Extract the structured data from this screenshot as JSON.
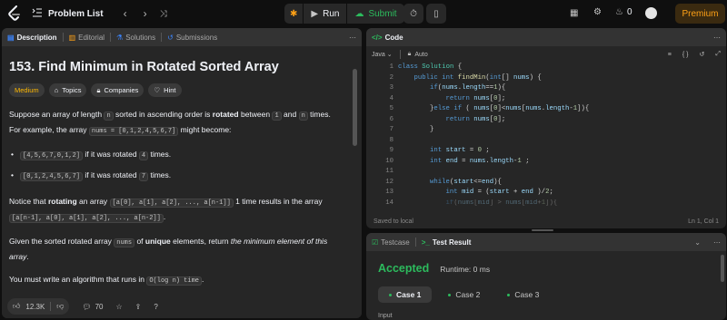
{
  "topbar": {
    "problem_list_label": "Problem List",
    "run_label": "Run",
    "submit_label": "Submit",
    "streak_count": "0",
    "premium_label": "Premium"
  },
  "description_panel": {
    "tabs": [
      {
        "label": "Description"
      },
      {
        "label": "Editorial"
      },
      {
        "label": "Solutions"
      },
      {
        "label": "Submissions"
      }
    ],
    "title": "153. Find Minimum in Rotated Sorted Array",
    "difficulty": "Medium",
    "tags": {
      "topics": "Topics",
      "companies": "Companies",
      "hint": "Hint"
    },
    "para1": {
      "a": "Suppose an array of length ",
      "n1": "n",
      "b": " sorted in ascending order is ",
      "rotated": "rotated",
      "c": " between ",
      "one": "1",
      "d": " and ",
      "n2": "n",
      "e": " times. For example, the array ",
      "nums": "nums = [0,1,2,4,5,6,7]",
      "f": " might become:"
    },
    "bullets": [
      {
        "code": "[4,5,6,7,0,1,2]",
        "text1": " if it was rotated ",
        "num": "4",
        "text2": " times."
      },
      {
        "code": "[0,1,2,4,5,6,7]",
        "text1": " if it was rotated ",
        "num": "7",
        "text2": " times."
      }
    ],
    "para2": {
      "a": "Notice that ",
      "rotating": "rotating",
      "b": " an array ",
      "code1": "[a[0], a[1], a[2], ..., a[n-1]]",
      "c": " 1 time results in the array ",
      "code2": "[a[n-1], a[0], a[1], a[2], ..., a[n-2]]",
      "d": "."
    },
    "para3": {
      "a": "Given the sorted rotated array ",
      "nums": "nums",
      "b": " of ",
      "unique": "unique",
      "c": " elements, return ",
      "em": "the minimum element of this array",
      "d": "."
    },
    "para4": {
      "a": "You must write an algorithm that runs in ",
      "code": "O(log n) time",
      "b": "."
    },
    "footer": {
      "likes": "12.3K",
      "comments": "70"
    }
  },
  "code_panel": {
    "tab_label": "Code",
    "language": "Java",
    "autosave": "Auto",
    "line_numbers": [
      "1",
      "2",
      "3",
      "4",
      "5",
      "6",
      "7",
      "8",
      "9",
      "10",
      "11",
      "12",
      "13",
      "14"
    ],
    "status_left": "Saved to local",
    "status_right": "Ln 1, Col 1"
  },
  "result_panel": {
    "tab_testcase": "Testcase",
    "tab_result": "Test Result",
    "verdict": "Accepted",
    "runtime": "Runtime: 0 ms",
    "cases": [
      "Case 1",
      "Case 2",
      "Case 3"
    ],
    "input_label": "Input"
  },
  "colors": {
    "accent": "#ffa116",
    "accepted": "#2cbb5d",
    "medium": "#ffb800"
  }
}
